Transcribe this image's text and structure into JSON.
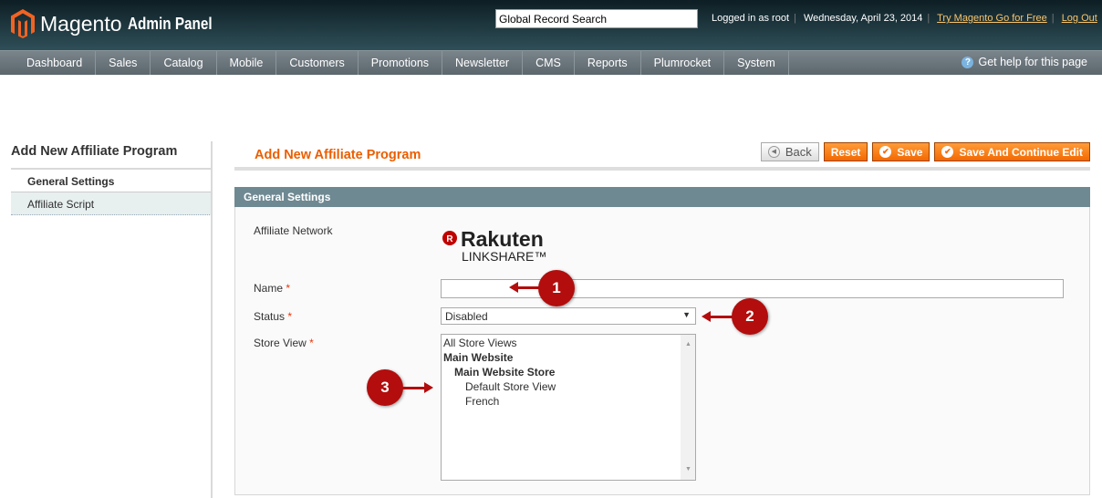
{
  "header": {
    "brand": "Magento",
    "brand_suffix": "Admin Panel",
    "search_value": "Global Record Search",
    "logged_in": "Logged in as root",
    "date": "Wednesday, April 23, 2014",
    "try_link": "Try Magento Go for Free",
    "logout": "Log Out"
  },
  "nav": {
    "items": [
      "Dashboard",
      "Sales",
      "Catalog",
      "Mobile",
      "Customers",
      "Promotions",
      "Newsletter",
      "CMS",
      "Reports",
      "Plumrocket",
      "System"
    ],
    "help": "Get help for this page"
  },
  "sidebar": {
    "title": "Add New Affiliate Program",
    "tabs": [
      "General Settings",
      "Affiliate Script"
    ]
  },
  "main": {
    "title": "Add New Affiliate Program",
    "buttons": {
      "back": "Back",
      "reset": "Reset",
      "save": "Save",
      "save_continue": "Save And Continue Edit"
    },
    "section": "General Settings",
    "fields": {
      "network_label": "Affiliate Network",
      "network_logo": "Rakuten LINKSHARE",
      "name_label": "Name",
      "name_value": "",
      "status_label": "Status",
      "status_value": "Disabled",
      "store_label": "Store View",
      "required": "*",
      "store_options": [
        "All Store Views",
        "Main Website",
        "Main Website Store",
        "Default Store View",
        "French"
      ]
    }
  },
  "annotations": [
    "1",
    "2",
    "3"
  ],
  "colors": {
    "accent": "#eb5e00",
    "section": "#6f8992",
    "annotation": "#b30d0d"
  }
}
